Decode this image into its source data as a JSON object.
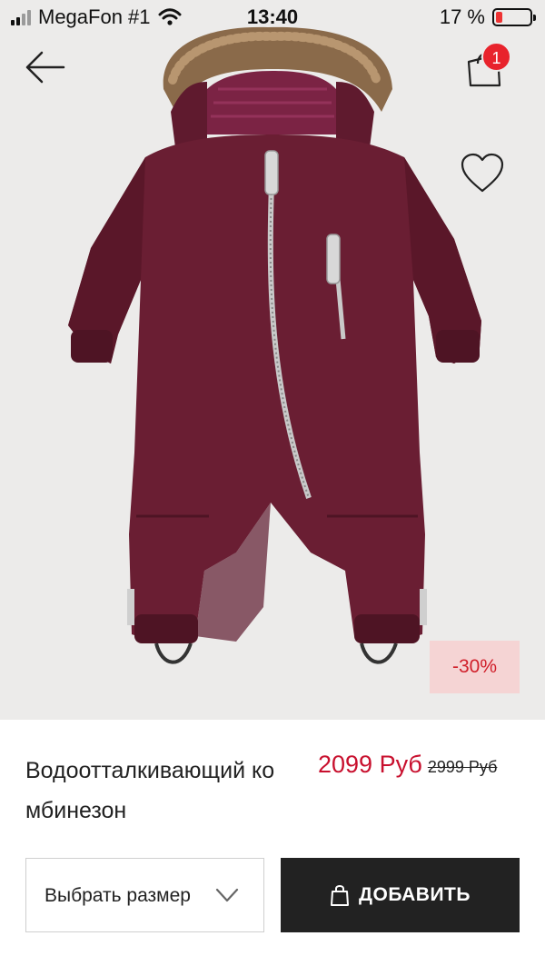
{
  "status_bar": {
    "carrier": "MegaFon #1",
    "time": "13:40",
    "battery_percent": "17 %",
    "battery_level": 0.17
  },
  "header": {
    "back_icon": "arrow-left-icon",
    "cart_icon": "shopping-bag-icon",
    "cart_count": "1",
    "favorite_icon": "heart-icon"
  },
  "product": {
    "image": "burgundy-snowsuit",
    "discount": "-30%",
    "name": "Водоотталкивающий комбинезон",
    "price": "2099 Руб",
    "old_price": "2999 Руб"
  },
  "actions": {
    "size_select": "Выбрать размер",
    "add_button": "ДОБАВИТЬ"
  },
  "colors": {
    "price": "#c8102e",
    "discount_bg": "#f5d4d4",
    "badge": "#e8232c",
    "button_bg": "#222222",
    "product": "#6a1e33"
  }
}
